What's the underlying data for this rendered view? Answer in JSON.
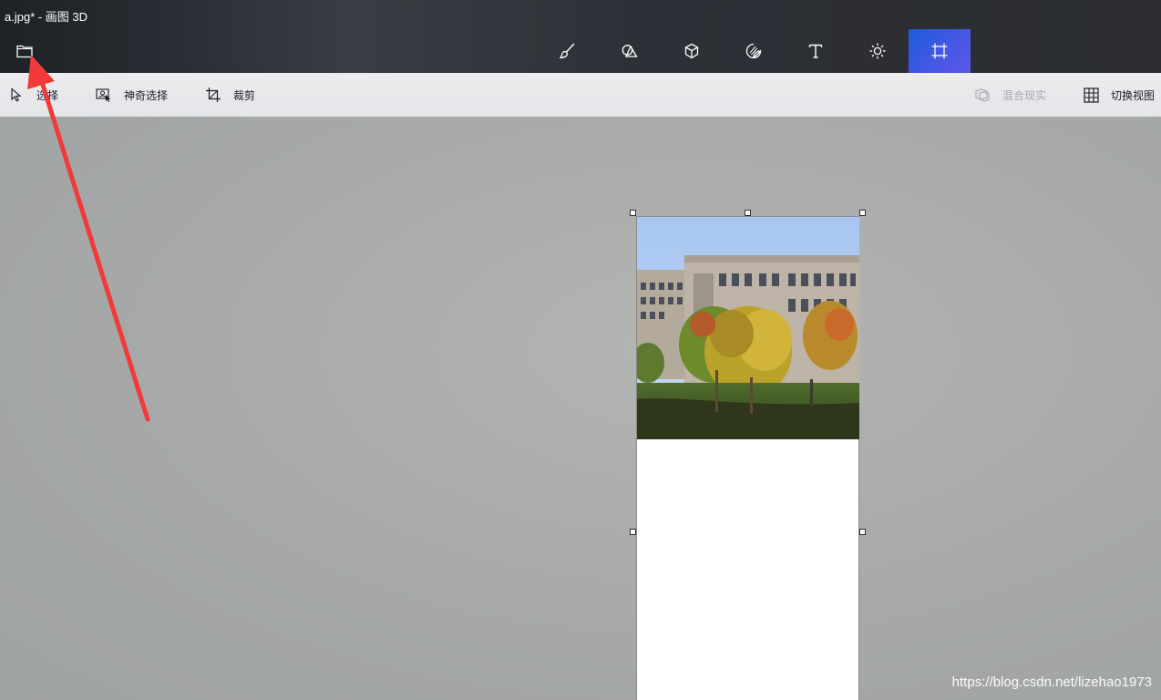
{
  "window": {
    "title": "a.jpg* - 画图 3D"
  },
  "menu": {
    "icon": "folder-icon"
  },
  "toolbar": {
    "tools": [
      {
        "name": "brushes",
        "icon": "brush-icon"
      },
      {
        "name": "2d-shapes",
        "icon": "2d-shapes-icon"
      },
      {
        "name": "3d-shapes",
        "icon": "3d-cube-icon"
      },
      {
        "name": "stickers",
        "icon": "sticker-icon"
      },
      {
        "name": "text",
        "icon": "text-t-icon"
      },
      {
        "name": "effects",
        "icon": "effects-sun-icon"
      },
      {
        "name": "canvas",
        "icon": "canvas-crop-icon",
        "active": true
      }
    ],
    "active_color": "#4857e6"
  },
  "subtoolbar": {
    "select_label": "选择",
    "magic_select_label": "神奇选择",
    "crop_label": "裁剪",
    "mixed_reality_label": "混合现实",
    "toggle_view_label": "切换视图"
  },
  "watermark": "https://blog.csdn.net/lizehao1973",
  "annotation": {
    "arrow_color": "#f23a3a"
  }
}
